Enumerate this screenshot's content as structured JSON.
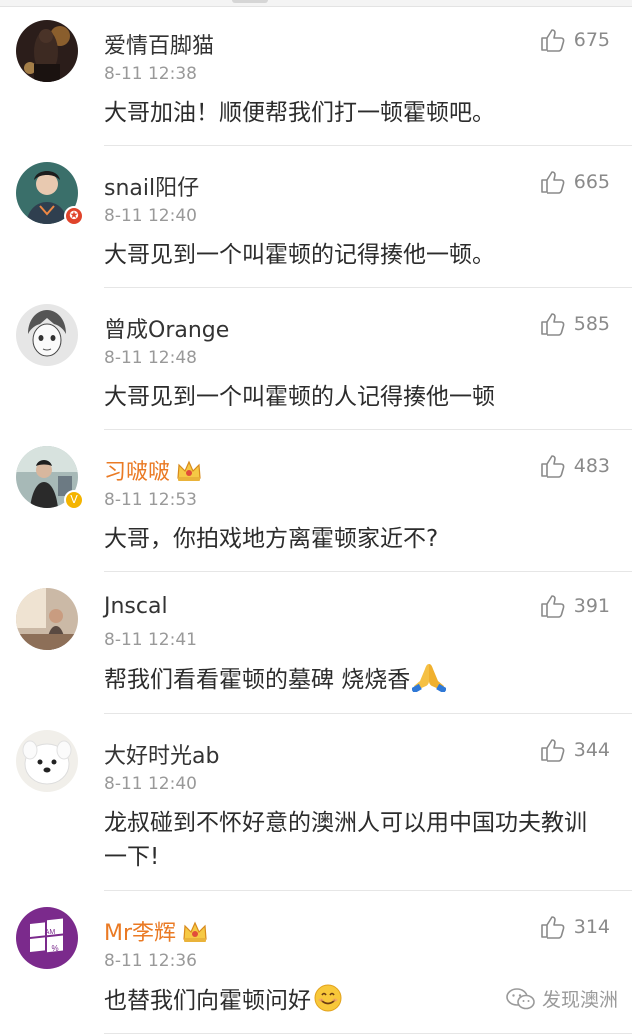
{
  "comments": [
    {
      "user": "爱情百脚猫",
      "time": "8-11 12:38",
      "likes": "675",
      "text": "大哥加油！顺便帮我们打一顿霍顿吧。",
      "vip": false
    },
    {
      "user": "snail阳仔",
      "time": "8-11 12:40",
      "likes": "665",
      "text": "大哥见到一个叫霍顿的记得揍他一顿。",
      "vip": false
    },
    {
      "user": "曾成Orange",
      "time": "8-11 12:48",
      "likes": "585",
      "text": "大哥见到一个叫霍顿的人记得揍他一顿",
      "vip": false
    },
    {
      "user": "习啵啵",
      "time": "8-11 12:53",
      "likes": "483",
      "text": "大哥，你拍戏地方离霍顿家近不?",
      "vip": true
    },
    {
      "user": "Jnscal",
      "time": "8-11 12:41",
      "likes": "391",
      "text": "帮我们看看霍顿的墓碑 烧烧香",
      "vip": false
    },
    {
      "user": "大好时光ab",
      "time": "8-11 12:40",
      "likes": "344",
      "text": "龙叔碰到不怀好意的澳洲人可以用中国功夫教训一下!",
      "vip": false
    },
    {
      "user": "Mr李辉",
      "time": "8-11 12:36",
      "likes": "314",
      "text": "也替我们向霍顿问好",
      "vip": true
    }
  ],
  "avatar_badges": {
    "red_star": "✪",
    "verified": "V"
  },
  "avatar_label": {
    "line1": "AM",
    "line2": "%"
  },
  "watermark": {
    "text": "发现澳洲"
  },
  "colors": {
    "vip_name": "#ea7a24",
    "red_badge": "#e0442b",
    "gold_badge": "#f4b400",
    "windows_tile": "#7b2a8c"
  }
}
